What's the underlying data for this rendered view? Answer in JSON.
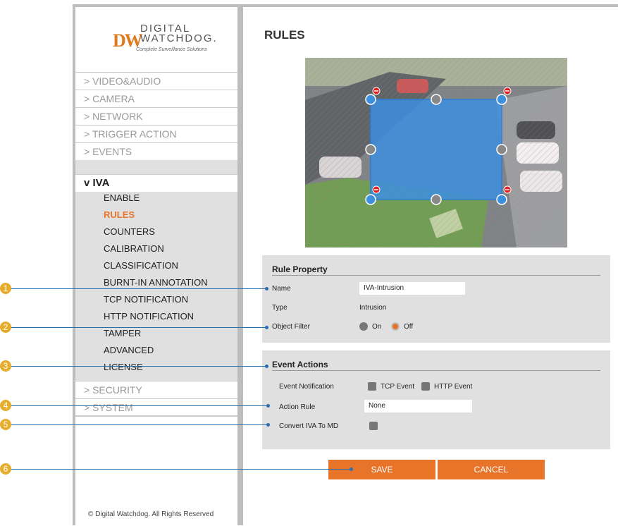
{
  "brand": {
    "logo_mark": "DW",
    "logo_line1": "DIGITAL",
    "logo_line2": "WATCHDOG.",
    "tagline": "Complete Surveillance Solutions"
  },
  "menu": [
    {
      "label": "> VIDEO&AUDIO"
    },
    {
      "label": "> CAMERA"
    },
    {
      "label": "> NETWORK"
    },
    {
      "label": "> TRIGGER ACTION"
    },
    {
      "label": "> EVENTS"
    },
    {
      "label": "v IVA"
    },
    {
      "label": "> SECURITY"
    },
    {
      "label": "> SYSTEM"
    }
  ],
  "iva_submenu": [
    "ENABLE",
    "RULES",
    "COUNTERS",
    "CALIBRATION",
    "CLASSIFICATION",
    "BURNT-IN ANNOTATION",
    "TCP NOTIFICATION",
    "HTTP NOTIFICATION",
    "TAMPER",
    "ADVANCED",
    "LICENSE"
  ],
  "active_submenu": "RULES",
  "footer": "© Digital Watchdog. All Rights Reserved",
  "page_title": "RULES",
  "rule_property": {
    "title": "Rule Property",
    "name_label": "Name",
    "name_value": "IVA-Intrusion",
    "type_label": "Type",
    "type_value": "Intrusion",
    "object_filter_label": "Object Filter",
    "on_label": "On",
    "off_label": "Off",
    "selected": "Off"
  },
  "event_actions": {
    "title": "Event Actions",
    "event_notification_label": "Event Notification",
    "tcp_event_label": "TCP Event",
    "http_event_label": "HTTP Event",
    "action_rule_label": "Action Rule",
    "action_rule_value": "None",
    "convert_label": "Convert IVA To MD"
  },
  "buttons": {
    "save": "SAVE",
    "cancel": "CANCEL"
  },
  "callouts": [
    "1",
    "2",
    "3",
    "4",
    "5",
    "6"
  ],
  "colors": {
    "accent": "#e8742a",
    "zone": "#3d8fe0",
    "callout": "#e6ac2e",
    "callout_line": "#2a6fb0"
  }
}
